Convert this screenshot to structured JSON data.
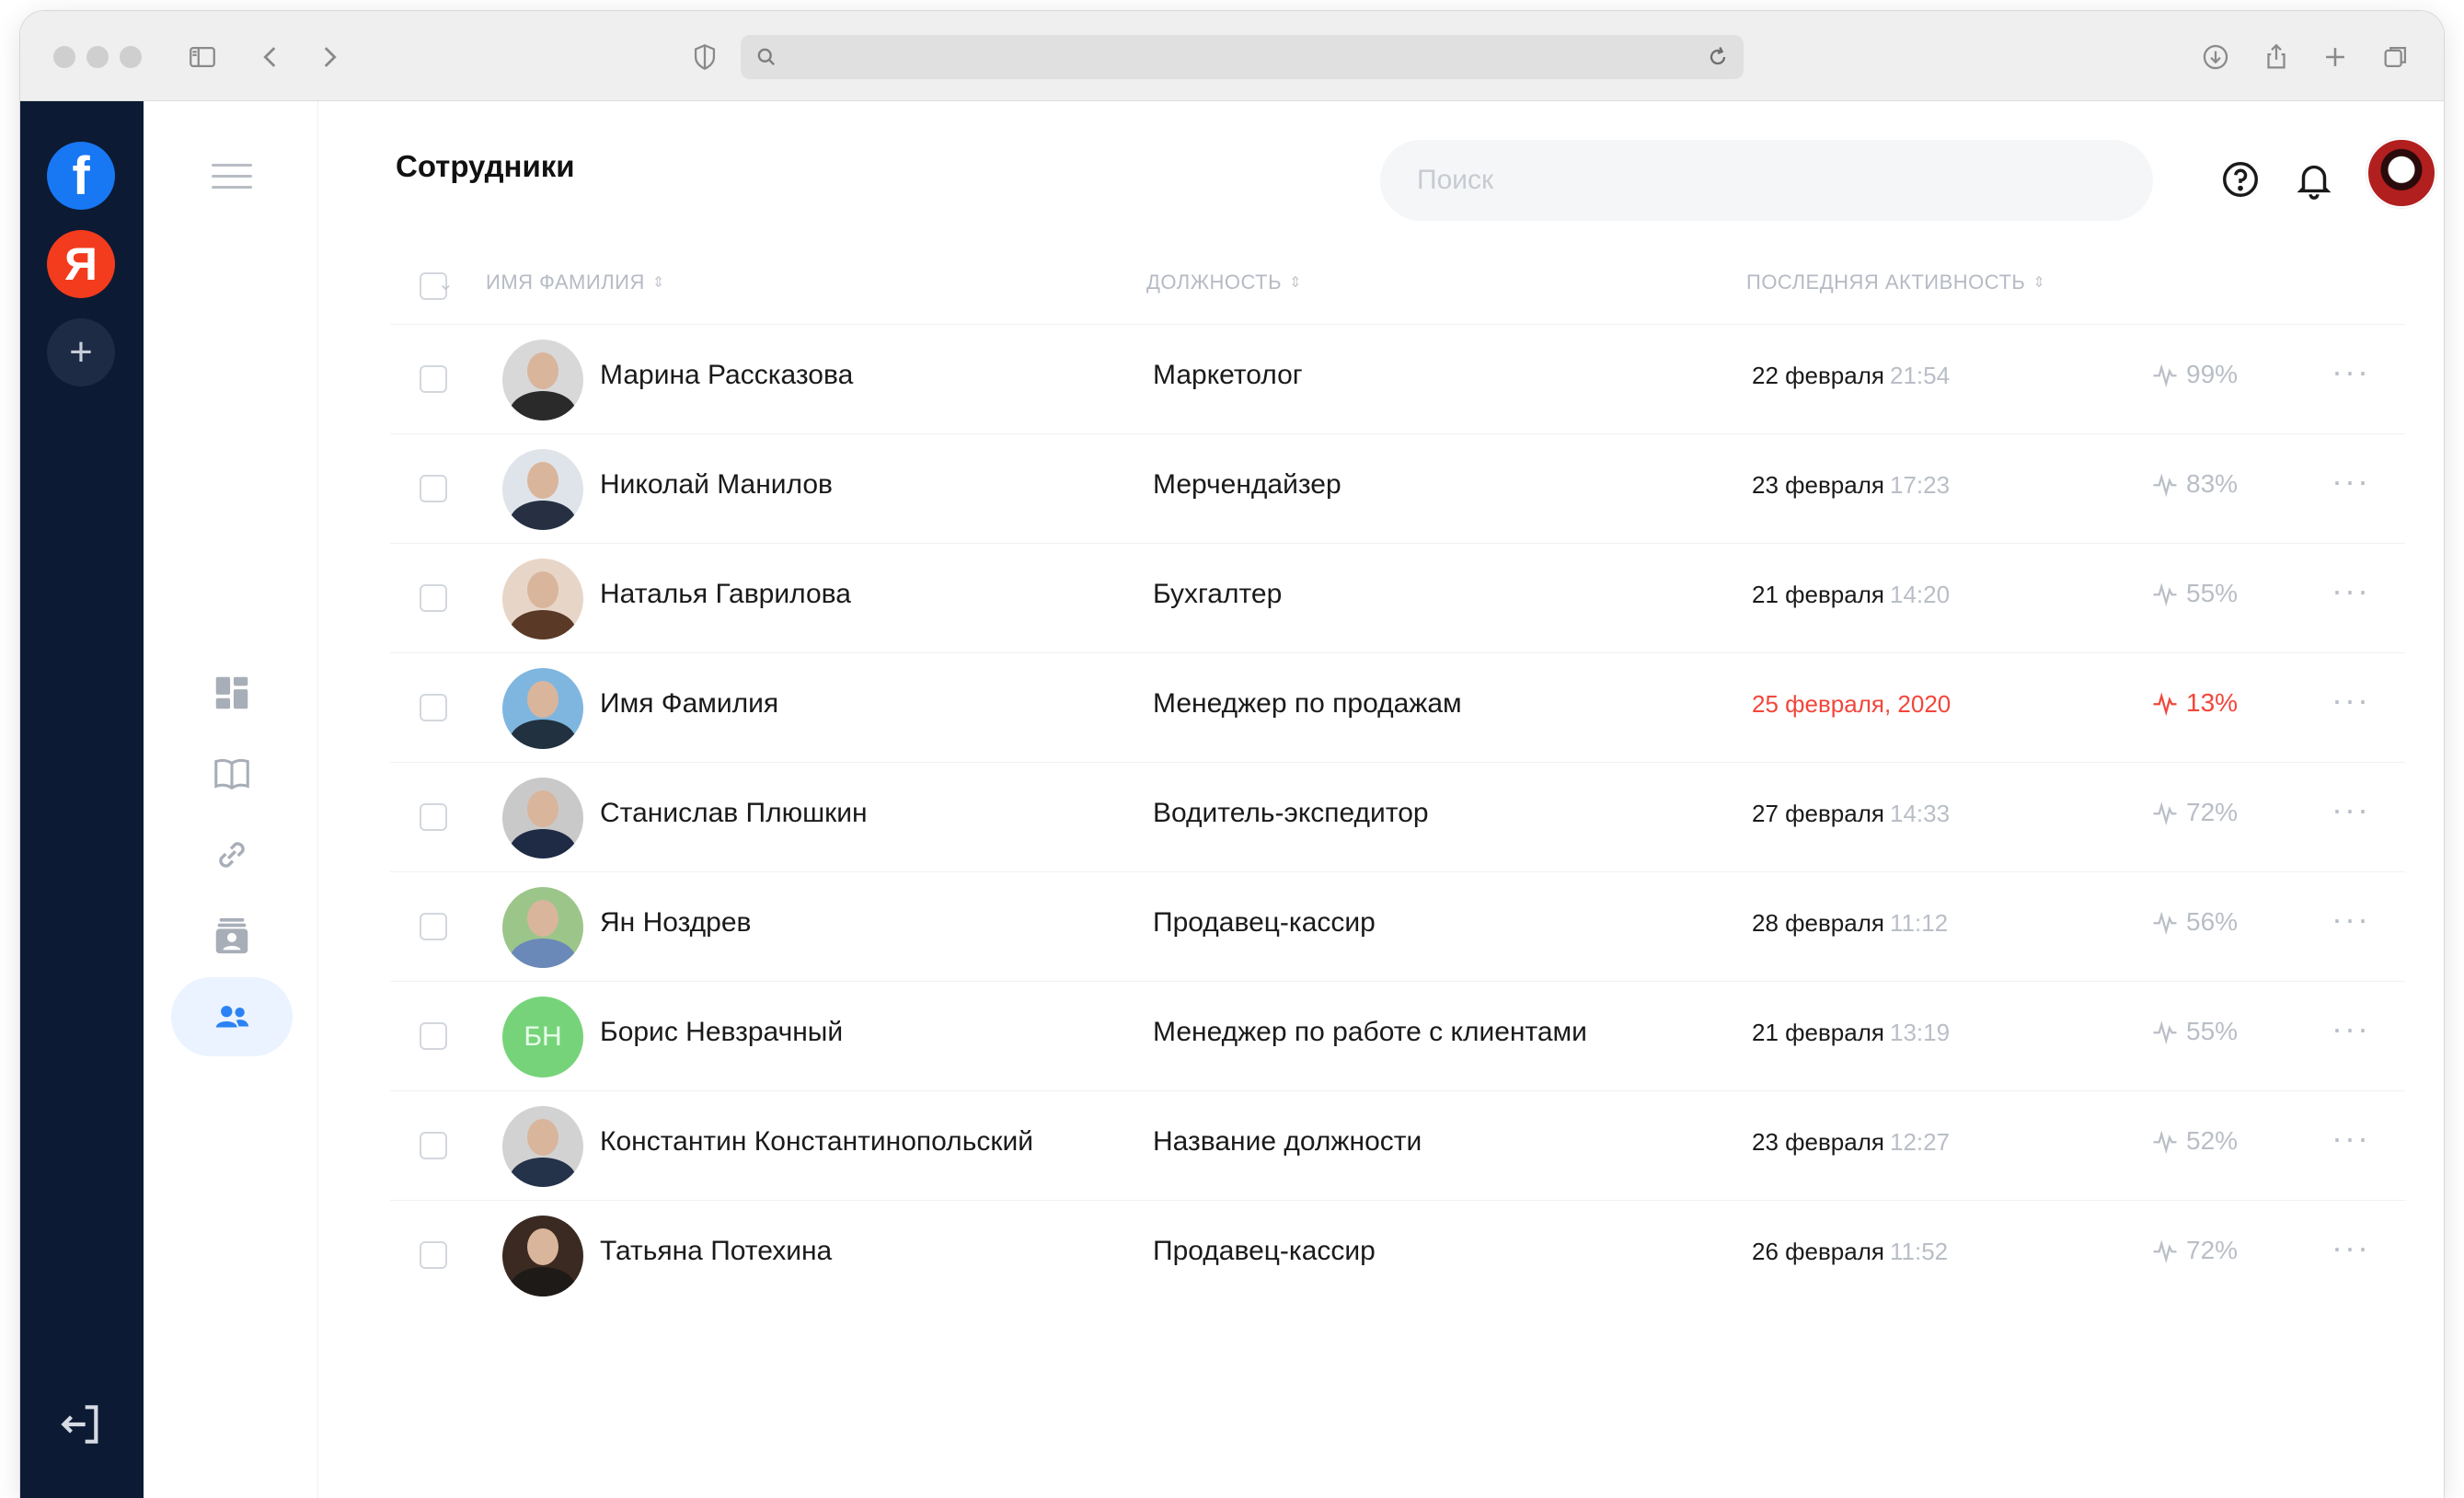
{
  "browser": {
    "address_value": "",
    "icons": [
      "sidebar-icon",
      "back-icon",
      "forward-icon",
      "shield-icon",
      "search-icon",
      "reload-icon",
      "download-icon",
      "share-icon",
      "new-tab-icon",
      "tabs-icon"
    ]
  },
  "rail": {
    "apps": [
      {
        "name": "facebook",
        "glyph": "f",
        "color": "#1877f2"
      },
      {
        "name": "yandex",
        "glyph": "Я",
        "color": "#f33b1e"
      }
    ],
    "add_glyph": "+"
  },
  "sidenav": {
    "items": [
      "dashboard-icon",
      "book-icon",
      "link-icon",
      "contact-card-icon",
      "users-icon"
    ],
    "active": "users-icon"
  },
  "header": {
    "title": "Сотрудники",
    "search_placeholder": "Поиск"
  },
  "table": {
    "columns": {
      "name": "Имя Фамилия",
      "position": "Должность",
      "activity": "Последняя активность"
    },
    "rows": [
      {
        "name": "Марина Рассказова",
        "position": "Маркетолог",
        "date": "22 февраля",
        "time": "21:54",
        "percent": "99%",
        "alert": false
      },
      {
        "name": "Николай Манилов",
        "position": "Мерчендайзер",
        "date": "23 февраля",
        "time": "17:23",
        "percent": "83%",
        "alert": false
      },
      {
        "name": "Наталья Гаврилова",
        "position": "Бухгалтер",
        "date": "21 февраля",
        "time": "14:20",
        "percent": "55%",
        "alert": false
      },
      {
        "name": "Имя Фамилия",
        "position": "Менеджер по продажам",
        "date": "25 февраля, 2020",
        "time": "",
        "percent": "13%",
        "alert": true
      },
      {
        "name": "Станислав Плюшкин",
        "position": "Водитель-экспедитор",
        "date": "27 февраля",
        "time": "14:33",
        "percent": "72%",
        "alert": false
      },
      {
        "name": "Ян Ноздрев",
        "position": "Продавец-кассир",
        "date": "28 февраля",
        "time": "11:12",
        "percent": "56%",
        "alert": false
      },
      {
        "name": "Борис Невзрачный",
        "position": "Менеджер по работе с клиентами",
        "date": "21 февраля",
        "time": "13:19",
        "percent": "55%",
        "alert": false,
        "initials": "БН"
      },
      {
        "name": "Константин Константинопольский",
        "position": "Название должности",
        "date": "23 февраля",
        "time": "12:27",
        "percent": "52%",
        "alert": false
      },
      {
        "name": "Татьяна Потехина",
        "position": "Продавец-кассир",
        "date": "26 февраля",
        "time": "11:52",
        "percent": "72%",
        "alert": false
      }
    ],
    "more_glyph": "···"
  },
  "colors": {
    "rail_bg": "#0c1a33",
    "accent": "#2a82f5",
    "alert": "#f2463b",
    "muted": "#b9bec6"
  }
}
